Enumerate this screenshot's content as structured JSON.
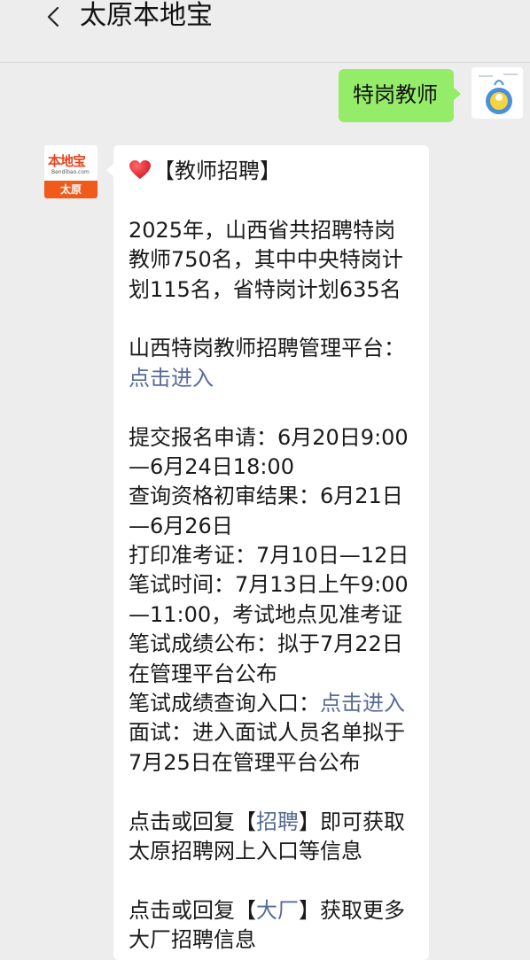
{
  "header": {
    "title": "太原本地宝"
  },
  "outgoing": {
    "text": "特岗教师"
  },
  "bot": {
    "avatar": {
      "logo_text": "本地宝",
      "logo_sub": "Bendibao.com",
      "city": "太原"
    }
  },
  "message": {
    "title": "【教师招聘】",
    "intro": [
      "2025年，山西省共招聘特岗",
      "教师750名，其中中央特岗计",
      "划115名，省特岗计划635名"
    ],
    "platform_label": "山西特岗教师招聘管理平台：",
    "platform_link": "点击进入",
    "schedule": [
      "提交报名申请：6月20日9:00",
      "—6月24日18:00",
      "查询资格初审结果：6月21日",
      "—6月26日",
      "打印准考证：7月10日—12日",
      "笔试时间：7月13日上午9:00",
      "—11:00，考试地点见准考证",
      "笔试成绩公布：拟于7月22日",
      "在管理平台公布"
    ],
    "score_query_label": "笔试成绩查询入口：",
    "score_query_link": "点击进入",
    "interview": [
      "面试：进入面试人员名单拟于",
      "7月25日在管理平台公布"
    ],
    "reply1_prefix": "点击或回复【",
    "reply1_keyword": "招聘",
    "reply1_suffix": "】即可获取",
    "reply1_line2": "太原招聘网上入口等信息",
    "reply2_prefix": "点击或回复【",
    "reply2_keyword": "大厂",
    "reply2_suffix": "】获取更多",
    "reply2_line2": "大厂招聘信息"
  },
  "colors": {
    "background": "#ededed",
    "outgoing_bubble": "#95ec69",
    "incoming_bubble": "#ffffff",
    "link": "#576b95",
    "logo_orange": "#f05a1a"
  }
}
